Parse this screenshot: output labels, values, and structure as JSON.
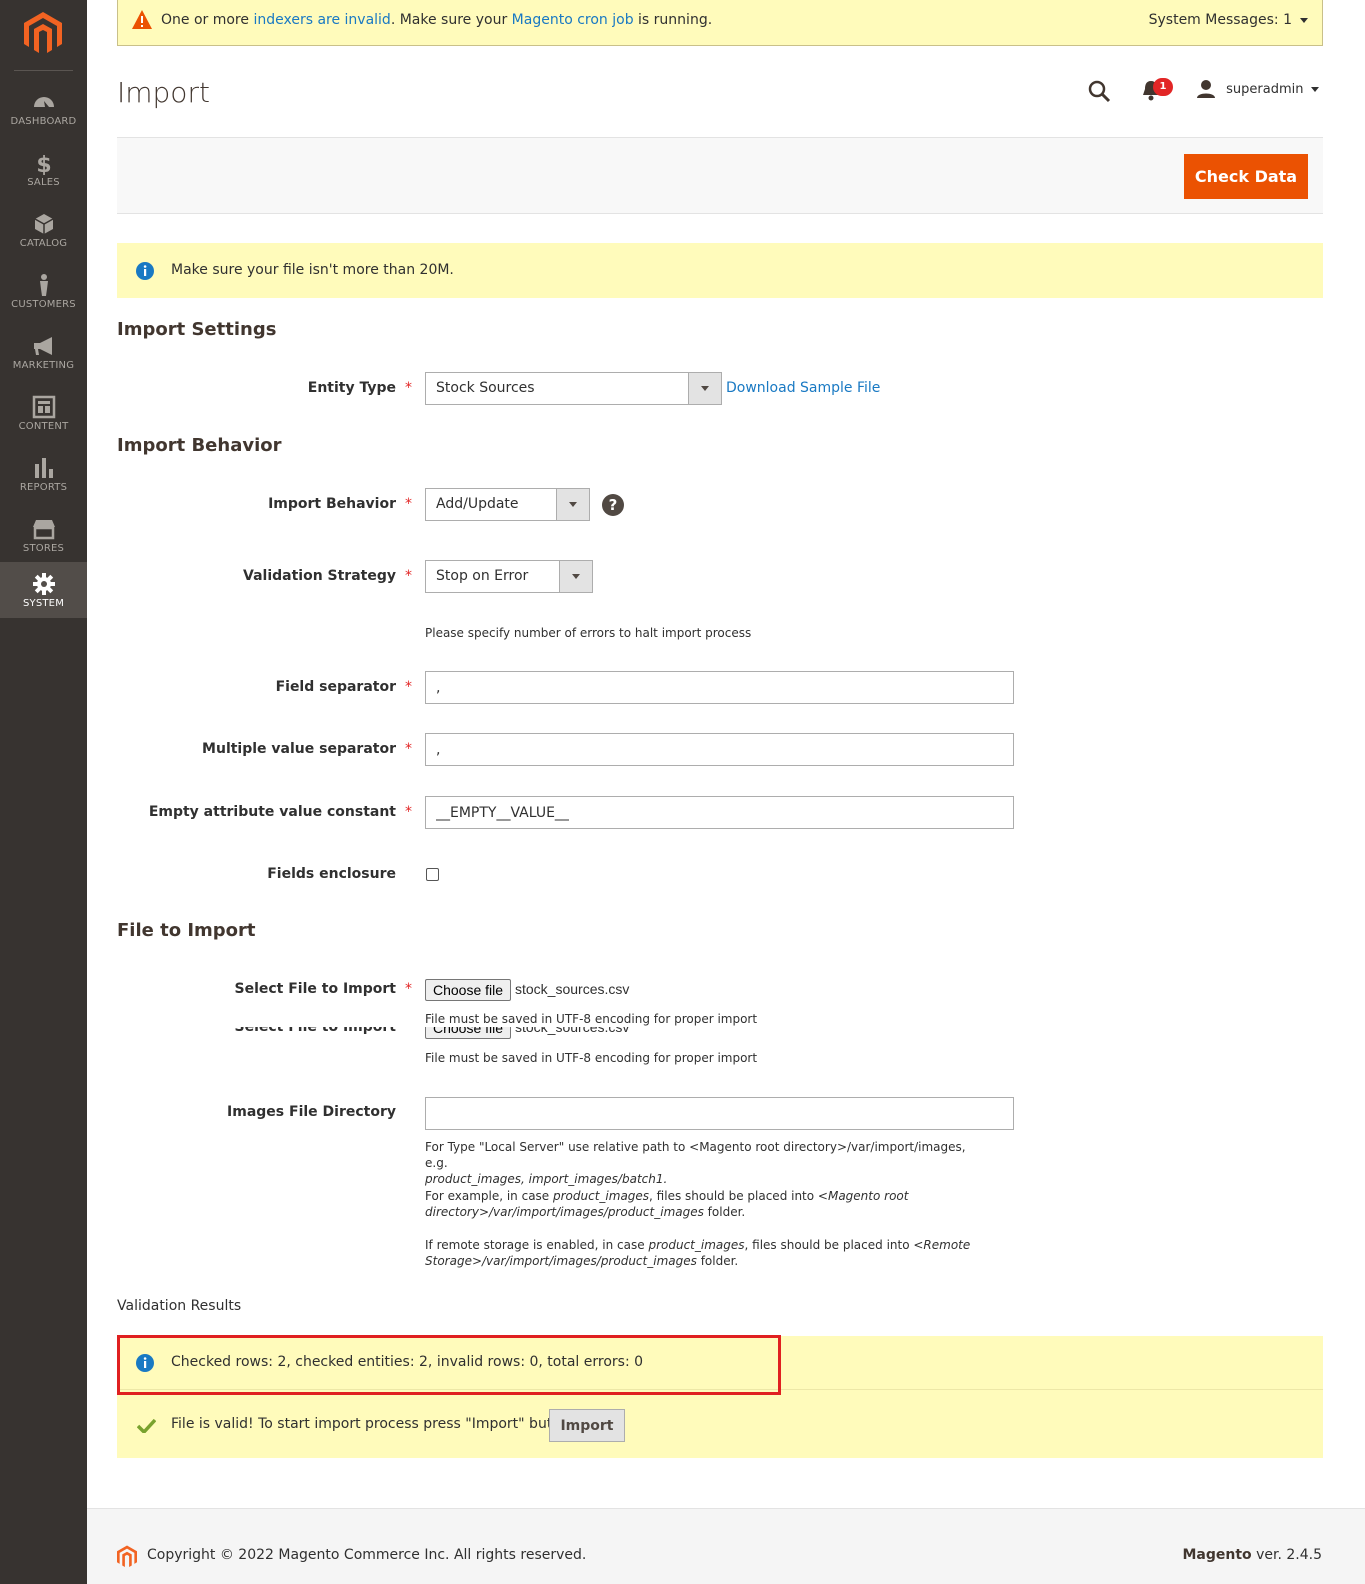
{
  "sidebar": {
    "items": [
      {
        "label": "DASHBOARD",
        "icon": "dashboard-icon"
      },
      {
        "label": "SALES",
        "icon": "dollar-icon"
      },
      {
        "label": "CATALOG",
        "icon": "cube-icon"
      },
      {
        "label": "CUSTOMERS",
        "icon": "person-icon"
      },
      {
        "label": "MARKETING",
        "icon": "megaphone-icon"
      },
      {
        "label": "CONTENT",
        "icon": "layout-icon"
      },
      {
        "label": "REPORTS",
        "icon": "bar-chart-icon"
      },
      {
        "label": "STORES",
        "icon": "store-icon"
      },
      {
        "label": "SYSTEM",
        "icon": "gear-icon"
      }
    ],
    "active": "SYSTEM"
  },
  "system_message": {
    "prefix": "One or more ",
    "link1": "indexers are invalid",
    "middle": ". Make sure your ",
    "link2": "Magento cron job",
    "suffix": " is running.",
    "count": "System Messages: 1"
  },
  "header": {
    "title": "Import",
    "notifications": "1",
    "user": "superadmin"
  },
  "actions": {
    "check_data": "Check Data"
  },
  "file_notice": "Make sure your file isn't more than 20M.",
  "import_settings": {
    "title": "Import Settings",
    "entity_type_label": "Entity Type",
    "entity_type_value": "Stock Sources",
    "download_sample": "Download Sample File"
  },
  "import_behavior": {
    "title": "Import Behavior",
    "behavior_label": "Import Behavior",
    "behavior_value": "Add/Update",
    "validation_label": "Validation Strategy",
    "validation_value": "Stop on Error",
    "errors_note": "Please specify number of errors to halt import process",
    "field_sep_label": "Field separator",
    "field_sep_value": ",",
    "multi_sep_label": "Multiple value separator",
    "multi_sep_value": ",",
    "empty_const_label": "Empty attribute value constant",
    "empty_const_value": "__EMPTY__VALUE__",
    "enclosure_label": "Fields enclosure"
  },
  "file_to_import": {
    "title": "File to Import",
    "select_label": "Select File to Import",
    "choose_button": "Choose file",
    "file_name": "stock_sources.csv",
    "encoding_note": "File must be saved in UTF-8 encoding for proper import",
    "images_dir_label": "Images File Directory",
    "images_note_1a": "For Type \"Local Server\" use relative path to <Magento root directory>/var/import/images, e.g.",
    "images_note_1b": "product_images, import_images/batch1.",
    "images_note_2a": "For example, in case ",
    "images_note_2b": "product_images",
    "images_note_2c": ", files should be placed into ",
    "images_note_2d": "<Magento root",
    "images_note_2e": "directory>/var/import/images/product_images",
    "images_note_2f": " folder.",
    "images_note_3a": "If remote storage is enabled, in case ",
    "images_note_3b": "product_images",
    "images_note_3c": ", files should be placed into ",
    "images_note_3d": "<Remote",
    "images_note_3e": "Storage>/var/import/images/product_images",
    "images_note_3f": " folder."
  },
  "validation": {
    "title": "Validation Results",
    "summary": "Checked rows: 2, checked entities: 2, invalid rows: 0, total errors: 0",
    "valid_message": "File is valid! To start import process press \"Import\" button",
    "import_button": "Import"
  },
  "footer": {
    "copyright": "Copyright © 2022 Magento Commerce Inc. All rights reserved.",
    "brand": "Magento",
    "version": " ver. 2.4.5"
  },
  "colors": {
    "accent": "#eb5202",
    "sidebar": "#373330",
    "notice_bg": "#fffbbb",
    "link": "#1979c3"
  }
}
